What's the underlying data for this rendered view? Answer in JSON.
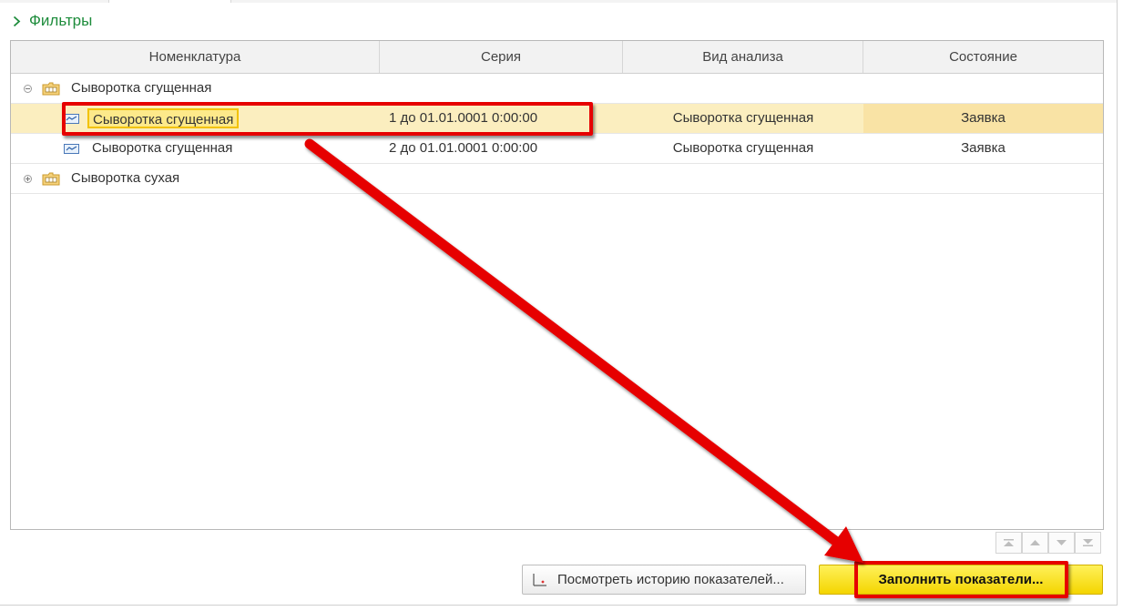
{
  "filters": {
    "label": "Фильтры"
  },
  "table": {
    "columns": [
      "Номенклатура",
      "Серия",
      "Вид анализа",
      "Состояние"
    ],
    "rows": [
      {
        "level": 0,
        "expander": "collapse",
        "icon": "folder-icon",
        "name": "Сыворотка сгущенная",
        "series": "",
        "analysis": "",
        "state": ""
      },
      {
        "level": 1,
        "icon": "chart-icon",
        "name": "Сыворотка сгущенная",
        "series": "1 до 01.01.0001 0:00:00",
        "analysis": "Сыворотка сгущенная",
        "state": "Заявка",
        "selected": true
      },
      {
        "level": 1,
        "icon": "chart-icon",
        "name": "Сыворотка сгущенная",
        "series": "2 до 01.01.0001 0:00:00",
        "analysis": "Сыворотка сгущенная",
        "state": "Заявка"
      },
      {
        "level": 0,
        "expander": "expand",
        "icon": "folder-icon",
        "name": "Сыворотка сухая",
        "series": "",
        "analysis": "",
        "state": ""
      }
    ]
  },
  "nav": [
    "move-first-icon",
    "move-up-icon",
    "move-down-icon",
    "move-last-icon"
  ],
  "buttons": {
    "history": "Посмотреть историю показателей...",
    "fill": "Заполнить показатели..."
  },
  "colors": {
    "accent_green": "#1e8c3c",
    "selected_row": "#fbeebf",
    "highlight_red": "#e60000",
    "primary_button": "#f4d500"
  }
}
